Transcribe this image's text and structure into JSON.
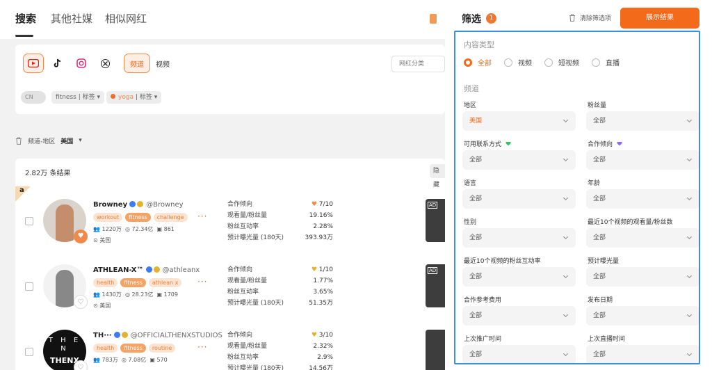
{
  "nav": {
    "tabs": [
      "搜索",
      "其他社媒",
      "相似网红"
    ]
  },
  "platforms": [
    "youtube",
    "tiktok",
    "instagram",
    "x"
  ],
  "content_tabs": [
    "频道",
    "视频"
  ],
  "filters_bar": {
    "toggle_label": "CN",
    "tag1_value": "fitness",
    "tag1_label": "标签",
    "tag2_value": "yoga",
    "tag2_label": "标签",
    "category_placeholder": "网红分类",
    "location_label": "频道-地区",
    "location_value": "美国"
  },
  "results": {
    "count": "2.82万 条结果",
    "hide_label": "隐藏"
  },
  "metric_labels": [
    "合作倾向",
    "观看量/粉丝量",
    "粉丝互动率",
    "预计曝光量 (180天)"
  ],
  "rows": [
    {
      "name": "Browney",
      "handle": "@Browney",
      "tags": [
        "workout",
        "fitness",
        "challenge"
      ],
      "subs": "1220万",
      "views": "72.34亿",
      "videos": "861",
      "location": "美国",
      "score": "7",
      "score_max": "/10",
      "view_ratio": "19.16%",
      "engagement": "2.28%",
      "exposure": "393.93万"
    },
    {
      "name": "ATHLEAN-X™",
      "handle": "@athleanx",
      "tags": [
        "health",
        "fitness",
        "athlean x"
      ],
      "subs": "1430万",
      "views": "28.23亿",
      "videos": "1709",
      "location": "美国",
      "score": "1",
      "score_max": "/10",
      "view_ratio": "1.77%",
      "engagement": "3.65%",
      "exposure": "51.35万"
    },
    {
      "name": "TH···",
      "handle": "@OFFICIALTHENXSTUDIOS",
      "tags": [
        "health",
        "fitness",
        "routine"
      ],
      "subs": "783万",
      "views": "7.08亿",
      "videos": "570",
      "location": "美国",
      "score": "3",
      "score_max": "/10",
      "view_ratio": "2.32%",
      "engagement": "2.9%",
      "exposure": "14.56万"
    }
  ],
  "avatar_text": {
    "letters": "T H E N",
    "big": "THENX"
  },
  "drawer": {
    "title": "筛选",
    "count": "1",
    "clear_label": "清除筛选项",
    "show_label": "展示结果",
    "content_type_title": "内容类型",
    "content_type_options": [
      "全部",
      "视频",
      "短视频",
      "直播"
    ],
    "channel_title": "频道",
    "fields": [
      {
        "label": "地区",
        "value": "美国"
      },
      {
        "label": "粉丝量",
        "value": "全部"
      },
      {
        "label": "可用联系方式",
        "value": "全部"
      },
      {
        "label": "合作倾向",
        "value": "全部"
      },
      {
        "label": "语言",
        "value": "全部"
      },
      {
        "label": "年龄",
        "value": "全部"
      },
      {
        "label": "性别",
        "value": "全部"
      },
      {
        "label": "最近10个视频的观看量/粉丝数",
        "value": "全部"
      },
      {
        "label": "最近10个视频的粉丝互动率",
        "value": "全部"
      },
      {
        "label": "预计曝光量",
        "value": "全部"
      },
      {
        "label": "合作参考费用",
        "value": "全部"
      },
      {
        "label": "发布日期",
        "value": "全部"
      },
      {
        "label": "上次推广时间",
        "value": "全部"
      },
      {
        "label": "上次直播时间",
        "value": "全部"
      }
    ]
  },
  "colors": {
    "accent": "#f36a1b",
    "focus_border": "#3a8fe0",
    "gem_green": "#36c46a",
    "gem_purple": "#8a6cf0"
  }
}
